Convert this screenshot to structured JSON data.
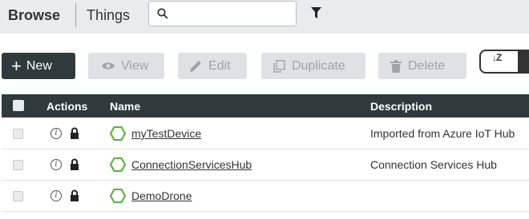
{
  "breadcrumb": {
    "root": "Browse",
    "current": "Things"
  },
  "search": {
    "value": "",
    "placeholder": ""
  },
  "toolbar": {
    "new_label": "New",
    "view_label": "View",
    "edit_label": "Edit",
    "duplicate_label": "Duplicate",
    "delete_label": "Delete",
    "sort_icon_label": "↓Z"
  },
  "table": {
    "headers": {
      "actions": "Actions",
      "name": "Name",
      "description": "Description"
    },
    "rows": [
      {
        "name": "myTestDevice",
        "description": "Imported from Azure IoT Hub"
      },
      {
        "name": "ConnectionServicesHub",
        "description": "Connection Services Hub"
      },
      {
        "name": "DemoDrone",
        "description": ""
      }
    ]
  },
  "icons": {
    "search": "search-icon",
    "filter": "filter-icon",
    "info": "info-icon",
    "lock": "lock-icon",
    "thing": "hexagon-icon"
  },
  "colors": {
    "primary_dark": "#2f3a3e",
    "thing_green": "#62b246",
    "disabled_bg": "#dee2e6",
    "disabled_text": "#9ea4aa",
    "topbar_bg": "#e9ecef"
  }
}
